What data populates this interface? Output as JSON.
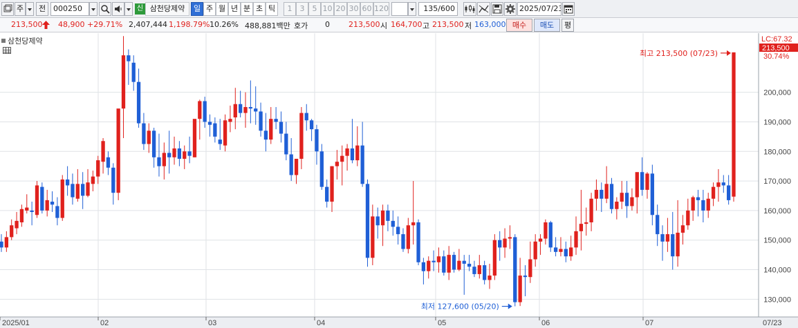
{
  "toolbar": {
    "period_label": "주",
    "prev_label": "전",
    "stock_code": "000250",
    "stock_badge": "신",
    "stock_name": "삼천당제약",
    "periods": [
      {
        "label": "일",
        "selected": true
      },
      {
        "label": "주",
        "selected": false
      },
      {
        "label": "월",
        "selected": false
      },
      {
        "label": "년",
        "selected": false
      },
      {
        "label": "분",
        "selected": false
      },
      {
        "label": "초",
        "selected": false
      },
      {
        "label": "틱",
        "selected": false
      }
    ],
    "intervals": [
      "1",
      "3",
      "5",
      "10",
      "20",
      "30",
      "60",
      "120"
    ],
    "count_display": "135",
    "count_max": "/600",
    "date": "2025/07/23"
  },
  "quote": {
    "price": "213,500",
    "change": "48,900",
    "change_pct": "+29.71%",
    "volume": "2,407,444",
    "volume_ratio": "1,198.79%",
    "turnover": "10.26%",
    "amount": "488,881백만",
    "hoga_label": "호가",
    "hoga_value": "0",
    "hoga_price": "213,500",
    "open_label": "시",
    "open": "164,700",
    "high_label": "고",
    "high": "213,500",
    "low_label": "저",
    "low": "163,000",
    "buy_label": "매수",
    "sell_label": "매도",
    "avg_label": "평"
  },
  "chart": {
    "legend": "삼천당제약",
    "right_label_lc": "LC:67.32",
    "right_label_price": "213,500",
    "right_label_pct": "30.74%",
    "high_annotation": "최고 213,500 (07/23)",
    "low_annotation": "최저 127,600 (05/20)",
    "y_ticks": [
      "200,000",
      "190,000",
      "180,000",
      "170,000",
      "160,000",
      "150,000",
      "140,000",
      "130,000"
    ],
    "x_ticks": [
      "2025/01",
      "02",
      "03",
      "04",
      "05",
      "06",
      "07",
      "07/23"
    ],
    "colors": {
      "up": "#e0211d",
      "down": "#1f5fd6",
      "grid": "#d8dbe0",
      "bg": "#ffffff"
    }
  },
  "chart_data": {
    "type": "candlestick",
    "title": "",
    "ylim": [
      124000,
      220000
    ],
    "y_ticks": [
      130000,
      140000,
      150000,
      160000,
      170000,
      180000,
      190000,
      200000
    ],
    "candles": [
      [
        149500,
        152000,
        146000,
        147500
      ],
      [
        147500,
        153000,
        146000,
        151000
      ],
      [
        151000,
        157000,
        150000,
        155000
      ],
      [
        154000,
        159500,
        152000,
        156500
      ],
      [
        156000,
        162000,
        154500,
        160500
      ],
      [
        160000,
        165500,
        159000,
        161000
      ],
      [
        160000,
        163000,
        155000,
        159500
      ],
      [
        158500,
        170000,
        157500,
        168500
      ],
      [
        168000,
        169500,
        159000,
        160000
      ],
      [
        160000,
        167000,
        158000,
        163500
      ],
      [
        163000,
        166500,
        159500,
        162000
      ],
      [
        161500,
        164500,
        155000,
        157500
      ],
      [
        157500,
        172000,
        156500,
        170500
      ],
      [
        170500,
        175000,
        165000,
        168500
      ],
      [
        169000,
        172500,
        162000,
        164500
      ],
      [
        164000,
        174000,
        163000,
        169000
      ],
      [
        169000,
        173000,
        160500,
        165000
      ],
      [
        165000,
        174000,
        164500,
        169500
      ],
      [
        169000,
        173500,
        166500,
        171500
      ],
      [
        171500,
        178500,
        169000,
        177000
      ],
      [
        176500,
        184500,
        172500,
        183500
      ],
      [
        178000,
        180000,
        172000,
        174500
      ],
      [
        174500,
        176000,
        162000,
        166000
      ],
      [
        166000,
        188000,
        163500,
        194500
      ],
      [
        194500,
        219000,
        184500,
        212500
      ],
      [
        212500,
        214500,
        202500,
        210500
      ],
      [
        210000,
        212500,
        200500,
        203500
      ],
      [
        203500,
        208000,
        188000,
        189500
      ],
      [
        189500,
        193000,
        180500,
        182500
      ],
      [
        182500,
        189500,
        179500,
        187000
      ],
      [
        187000,
        188000,
        174500,
        178000
      ],
      [
        178000,
        186000,
        171500,
        175000
      ],
      [
        175000,
        183000,
        170500,
        179500
      ],
      [
        179500,
        187000,
        172500,
        178000
      ],
      [
        178000,
        185000,
        175500,
        181000
      ],
      [
        181000,
        183500,
        175000,
        177500
      ],
      [
        177500,
        182000,
        174000,
        180000
      ],
      [
        180000,
        185000,
        176000,
        178500
      ],
      [
        178000,
        188000,
        178000,
        191000
      ],
      [
        191000,
        197500,
        184000,
        197000
      ],
      [
        197000,
        198500,
        188000,
        190000
      ],
      [
        190000,
        192500,
        185000,
        189000
      ],
      [
        189500,
        191500,
        183000,
        185000
      ],
      [
        184000,
        191000,
        180500,
        182500
      ],
      [
        182000,
        192500,
        180000,
        190500
      ],
      [
        190000,
        195500,
        186500,
        191000
      ],
      [
        191500,
        201500,
        187500,
        196000
      ],
      [
        196000,
        200500,
        191500,
        193000
      ],
      [
        193000,
        200000,
        188000,
        195000
      ],
      [
        195000,
        204000,
        189500,
        194500
      ],
      [
        194500,
        202000,
        189000,
        193500
      ],
      [
        193500,
        196500,
        185000,
        187000
      ],
      [
        187000,
        193000,
        180000,
        184000
      ],
      [
        184000,
        195000,
        182500,
        191000
      ],
      [
        191000,
        195000,
        187500,
        190000
      ],
      [
        190000,
        193500,
        183000,
        186000
      ],
      [
        186000,
        190000,
        177000,
        179000
      ],
      [
        179000,
        184500,
        170000,
        172000
      ],
      [
        172000,
        176000,
        169000,
        177500
      ],
      [
        177500,
        195000,
        174000,
        193000
      ],
      [
        193000,
        196000,
        187000,
        190500
      ],
      [
        190500,
        191000,
        183500,
        187500
      ],
      [
        187500,
        189000,
        175500,
        180000
      ],
      [
        180000,
        182500,
        167000,
        168000
      ],
      [
        168000,
        170500,
        161000,
        163000
      ],
      [
        163000,
        175000,
        159500,
        175000
      ],
      [
        175000,
        180500,
        170500,
        176500
      ],
      [
        176500,
        182000,
        168500,
        178500
      ],
      [
        178500,
        182500,
        173500,
        181000
      ],
      [
        181000,
        191000,
        176000,
        177000
      ],
      [
        177000,
        188500,
        175000,
        182000
      ],
      [
        182000,
        190000,
        168000,
        169000
      ],
      [
        169000,
        170500,
        141000,
        144000
      ],
      [
        144000,
        162000,
        141500,
        158000
      ],
      [
        158000,
        161000,
        150500,
        155000
      ],
      [
        155000,
        162000,
        148000,
        160000
      ],
      [
        160000,
        162000,
        153000,
        156500
      ],
      [
        156500,
        160000,
        151500,
        154500
      ],
      [
        154500,
        158000,
        148500,
        152000
      ],
      [
        152000,
        154000,
        146000,
        147000
      ],
      [
        147000,
        157500,
        145500,
        155000
      ],
      [
        155000,
        170000,
        148500,
        156000
      ],
      [
        156000,
        157000,
        141500,
        142500
      ],
      [
        142500,
        144000,
        135000,
        139500
      ],
      [
        139500,
        144500,
        137000,
        143000
      ],
      [
        143000,
        146500,
        139500,
        142500
      ],
      [
        142500,
        147500,
        139000,
        144500
      ],
      [
        144500,
        146500,
        138000,
        139000
      ],
      [
        139000,
        148000,
        136500,
        145000
      ],
      [
        145000,
        146000,
        139000,
        140000
      ],
      [
        140000,
        147000,
        139500,
        143000
      ],
      [
        143000,
        145000,
        131500,
        142000
      ],
      [
        142000,
        145000,
        139500,
        141000
      ],
      [
        141000,
        143000,
        137500,
        138500
      ],
      [
        138500,
        145000,
        137000,
        141500
      ],
      [
        141500,
        143000,
        135000,
        136500
      ],
      [
        136500,
        142000,
        133500,
        138000
      ],
      [
        138000,
        152000,
        136500,
        150000
      ],
      [
        150000,
        153000,
        143000,
        147500
      ],
      [
        147500,
        154000,
        144000,
        150500
      ],
      [
        150500,
        155000,
        147000,
        151000
      ],
      [
        151000,
        152000,
        127600,
        129000
      ],
      [
        129000,
        144000,
        127700,
        138000
      ],
      [
        138000,
        141500,
        131000,
        137500
      ],
      [
        137500,
        149500,
        135500,
        143500
      ],
      [
        143500,
        152000,
        141000,
        149500
      ],
      [
        149500,
        152000,
        145000,
        150500
      ],
      [
        150500,
        157000,
        148500,
        156000
      ],
      [
        156000,
        156500,
        146000,
        147500
      ],
      [
        147500,
        151000,
        144500,
        146000
      ],
      [
        146000,
        151000,
        144500,
        147000
      ],
      [
        147000,
        149500,
        142500,
        144500
      ],
      [
        144500,
        151500,
        143000,
        147500
      ],
      [
        147500,
        158000,
        145000,
        153000
      ],
      [
        153000,
        167000,
        146500,
        155500
      ],
      [
        155500,
        161000,
        151500,
        156000
      ],
      [
        156000,
        166000,
        153000,
        164000
      ],
      [
        164000,
        170500,
        160000,
        167000
      ],
      [
        167000,
        169500,
        159500,
        164000
      ],
      [
        164000,
        175000,
        162500,
        169000
      ],
      [
        169000,
        171000,
        159000,
        160500
      ],
      [
        160500,
        164500,
        157000,
        163000
      ],
      [
        163000,
        170000,
        160500,
        166000
      ],
      [
        166000,
        170000,
        157500,
        161500
      ],
      [
        161500,
        167500,
        160000,
        164500
      ],
      [
        164500,
        170000,
        159000,
        173000
      ],
      [
        173000,
        178000,
        165000,
        167000
      ],
      [
        167000,
        173000,
        164000,
        172500
      ],
      [
        172500,
        175500,
        155000,
        158500
      ],
      [
        158500,
        162000,
        148000,
        152000
      ],
      [
        152000,
        155000,
        143000,
        149500
      ],
      [
        149500,
        157500,
        146000,
        152000
      ],
      [
        152000,
        159500,
        140000,
        144500
      ],
      [
        144500,
        163500,
        141000,
        152500
      ],
      [
        152500,
        158500,
        148500,
        155000
      ],
      [
        155000,
        164000,
        153500,
        160000
      ],
      [
        160000,
        165000,
        156500,
        164500
      ],
      [
        164500,
        167000,
        158000,
        163500
      ],
      [
        163500,
        167000,
        156000,
        160000
      ],
      [
        160000,
        166000,
        157500,
        164000
      ],
      [
        164000,
        169500,
        161500,
        168000
      ],
      [
        168000,
        174000,
        163000,
        169500
      ],
      [
        169500,
        172000,
        166000,
        168500
      ],
      [
        168500,
        172000,
        162000,
        163500
      ],
      [
        164700,
        213500,
        163000,
        213500
      ]
    ]
  }
}
